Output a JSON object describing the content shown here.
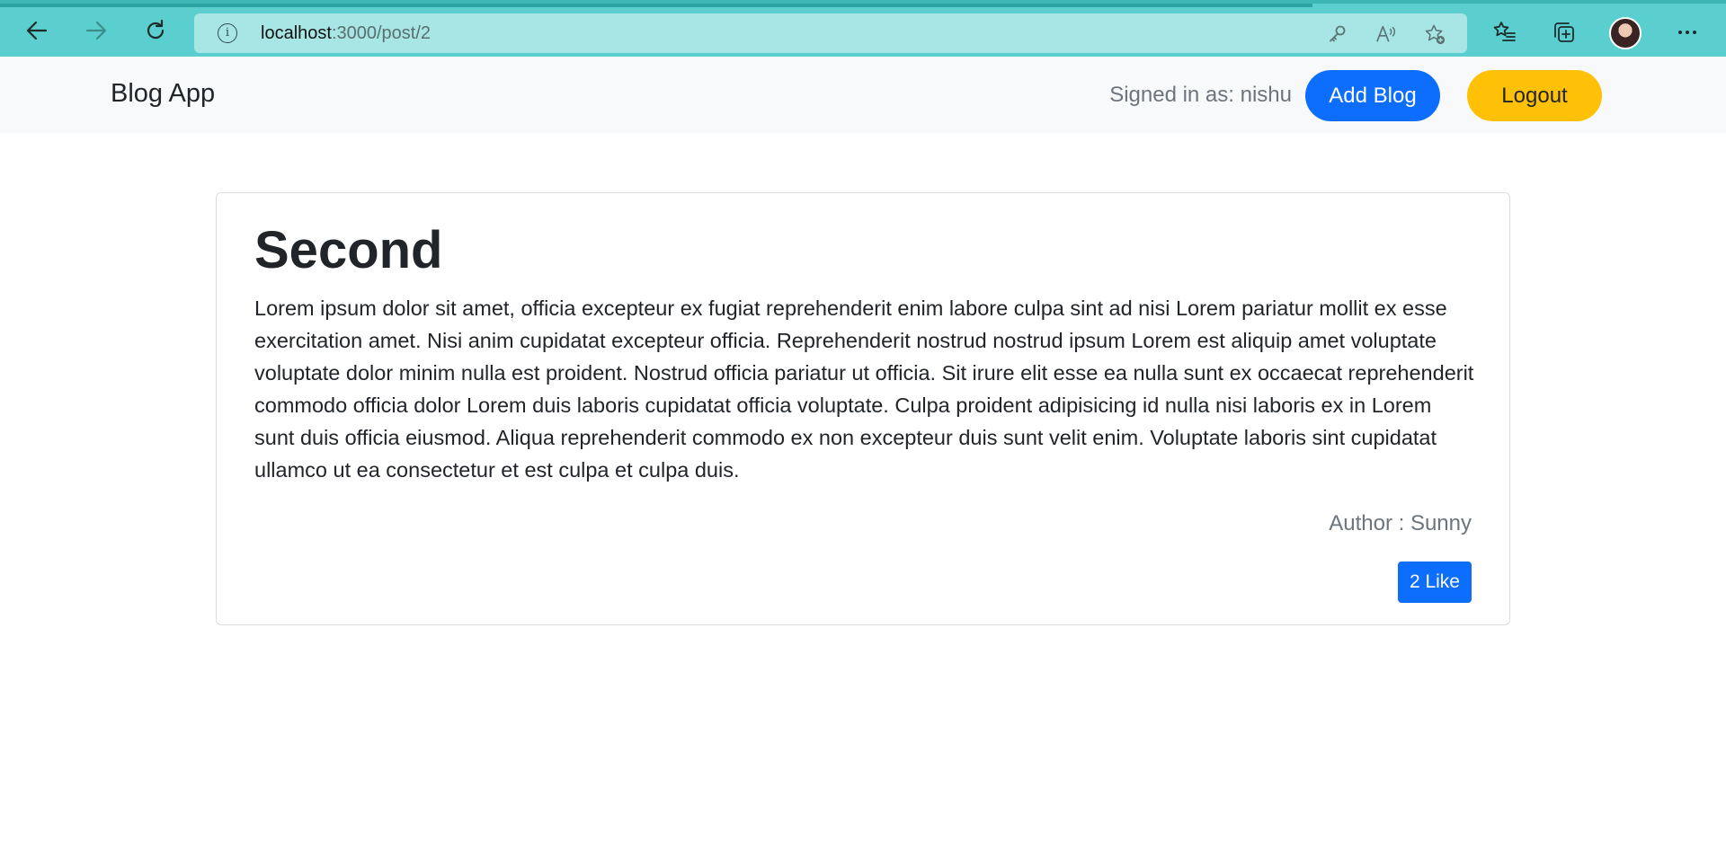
{
  "browser": {
    "url_host": "localhost",
    "url_path": ":3000/post/2",
    "icons": {
      "back": "arrow-left-icon",
      "forward": "arrow-right-icon",
      "refresh": "refresh-icon",
      "site_info": "info-icon",
      "password": "key-icon",
      "read_aloud": "read-aloud-icon",
      "add_favorite": "star-plus-icon",
      "favorites": "favorites-list-icon",
      "collections": "collections-icon",
      "more": "more-icon"
    },
    "colors": {
      "toolbar": "#5bcfcf",
      "address_bar": "#a8e6e6"
    }
  },
  "navbar": {
    "brand": "Blog App",
    "signed_in_text": "Signed in as: nishu",
    "add_blog_label": "Add Blog",
    "logout_label": "Logout",
    "colors": {
      "add_blog": "#0d6efd",
      "logout": "#ffc107"
    }
  },
  "post": {
    "title": "Second",
    "body": "Lorem ipsum dolor sit amet, officia excepteur ex fugiat reprehenderit enim labore culpa sint ad nisi Lorem pariatur mollit ex esse exercitation amet. Nisi anim cupidatat excepteur officia. Reprehenderit nostrud nostrud ipsum Lorem est aliquip amet voluptate voluptate dolor minim nulla est proident. Nostrud officia pariatur ut officia. Sit irure elit esse ea nulla sunt ex occaecat reprehenderit commodo officia dolor Lorem duis laboris cupidatat officia voluptate. Culpa proident adipisicing id nulla nisi laboris ex in Lorem sunt duis officia eiusmod. Aliqua reprehenderit commodo ex non excepteur duis sunt velit enim. Voluptate laboris sint cupidatat ullamco ut ea consectetur et est culpa et culpa duis.",
    "author": "Author : Sunny",
    "like_label": "2 Like"
  }
}
